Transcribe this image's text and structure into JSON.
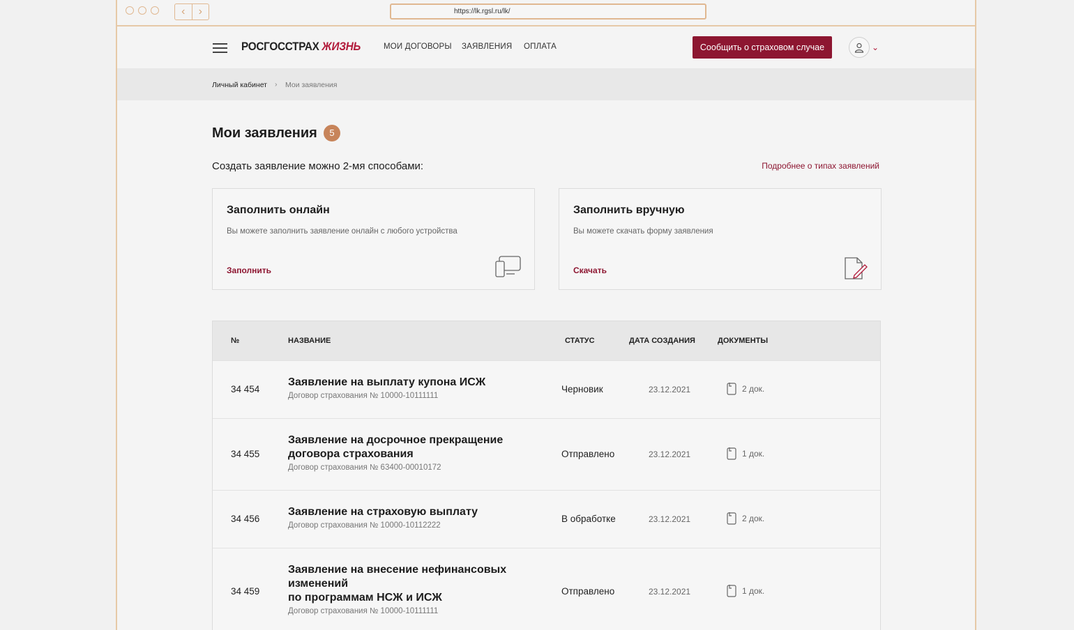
{
  "browser": {
    "url": "https://lk.rgsl.ru/lk/"
  },
  "header": {
    "logo_part1": "РОСГОССТРАХ",
    "logo_part2": "ЖИЗНЬ",
    "nav": [
      "МОИ ДОГОВОРЫ",
      "ЗАЯВЛЕНИЯ",
      "ОПЛАТА"
    ],
    "report_button": "Сообщить о страховом случае"
  },
  "breadcrumb": {
    "root": "Личный кабинет",
    "separator": "›",
    "current": "Мои заявления"
  },
  "page": {
    "title": "Мои заявления",
    "count": "5",
    "subtitle": "Создать заявление можно 2-мя способами:",
    "more_link": "Подробнее о типах заявлений"
  },
  "cards": [
    {
      "title": "Заполнить онлайн",
      "text": "Вы можете заполнить заявление онлайн с любого устройства",
      "action": "Заполнить",
      "icon": "devices-icon"
    },
    {
      "title": "Заполнить вручную",
      "text": "Вы можете скачать форму заявления",
      "action": "Скачать",
      "icon": "document-edit-icon"
    }
  ],
  "table": {
    "headers": [
      "№",
      "НАЗВАНИЕ",
      "СТАТУС",
      "ДАТА СОЗДАНИЯ",
      "ДОКУМЕНТЫ"
    ],
    "rows": [
      {
        "num": "34 454",
        "title": "Заявление на выплату купона ИСЖ",
        "contract": "Договор страхования № 10000-10111111",
        "status": "Черновик",
        "date": "23.12.2021",
        "docs": "2 док."
      },
      {
        "num": "34 455",
        "title": "Заявление на досрочное прекращение договора страхования",
        "contract": "Договор страхования № 63400-00010172",
        "status": "Отправлено",
        "date": "23.12.2021",
        "docs": "1 док."
      },
      {
        "num": "34 456",
        "title": "Заявление на страховую выплату",
        "contract": "Договор страхования № 10000-10112222",
        "status": "В обработке",
        "date": "23.12.2021",
        "docs": "2 док."
      },
      {
        "num": "34 459",
        "title": "Заявление на внесение нефинансовых изменений\nпо программам НСЖ и ИСЖ",
        "contract": "Договор страхования № 10000-10111111",
        "status": "Отправлено",
        "date": "23.12.2021",
        "docs": "1 док."
      }
    ]
  },
  "colors": {
    "brand": "#8d1631",
    "badge": "#c7845a",
    "frame": "#e6c9a7"
  }
}
